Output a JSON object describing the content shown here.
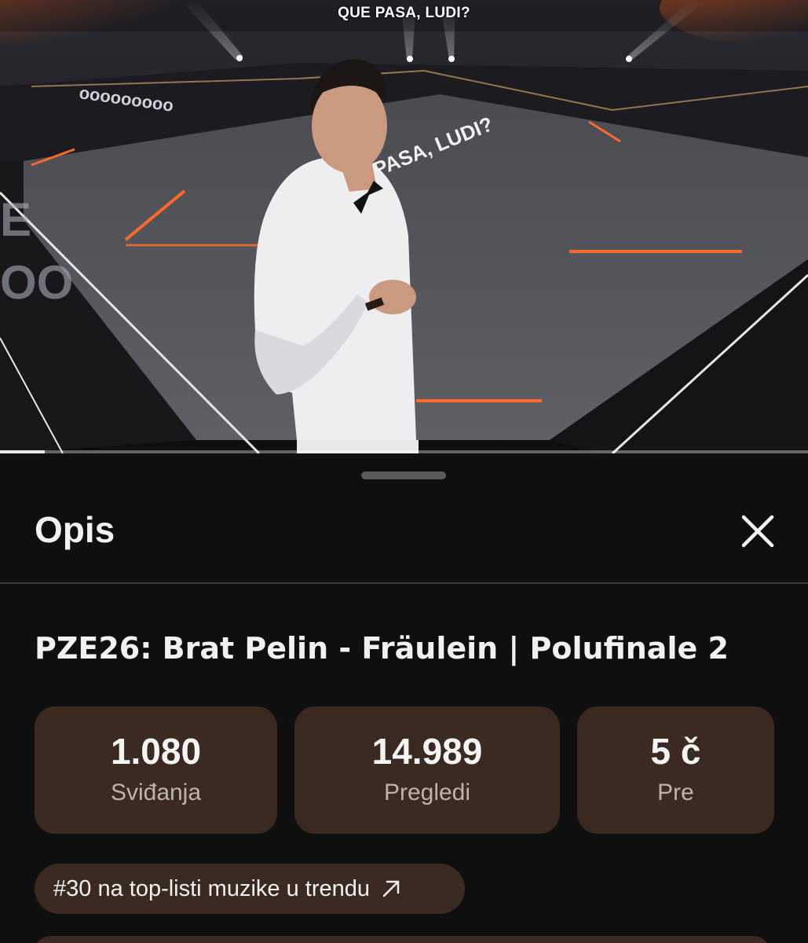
{
  "video": {
    "caption": "QUE PASA, LUDI?",
    "progress_fraction": 0.055
  },
  "sheet": {
    "title": "Opis",
    "close_icon": "close-icon"
  },
  "video_title": "PZE26: Brat Pelin - Fräulein | Polufinale 2",
  "stats": [
    {
      "value": "1.080",
      "label": "Sviđanja"
    },
    {
      "value": "14.989",
      "label": "Pregledi"
    },
    {
      "value": "5 č",
      "label": "Pre"
    }
  ],
  "trending_chip": {
    "label": "#30 na top-listi muzike u trendu",
    "icon": "arrow-up-right-icon"
  },
  "colors": {
    "background": "#0f0f0f",
    "card": "#3a2a22",
    "stage_neon": "#ff6a2a"
  }
}
